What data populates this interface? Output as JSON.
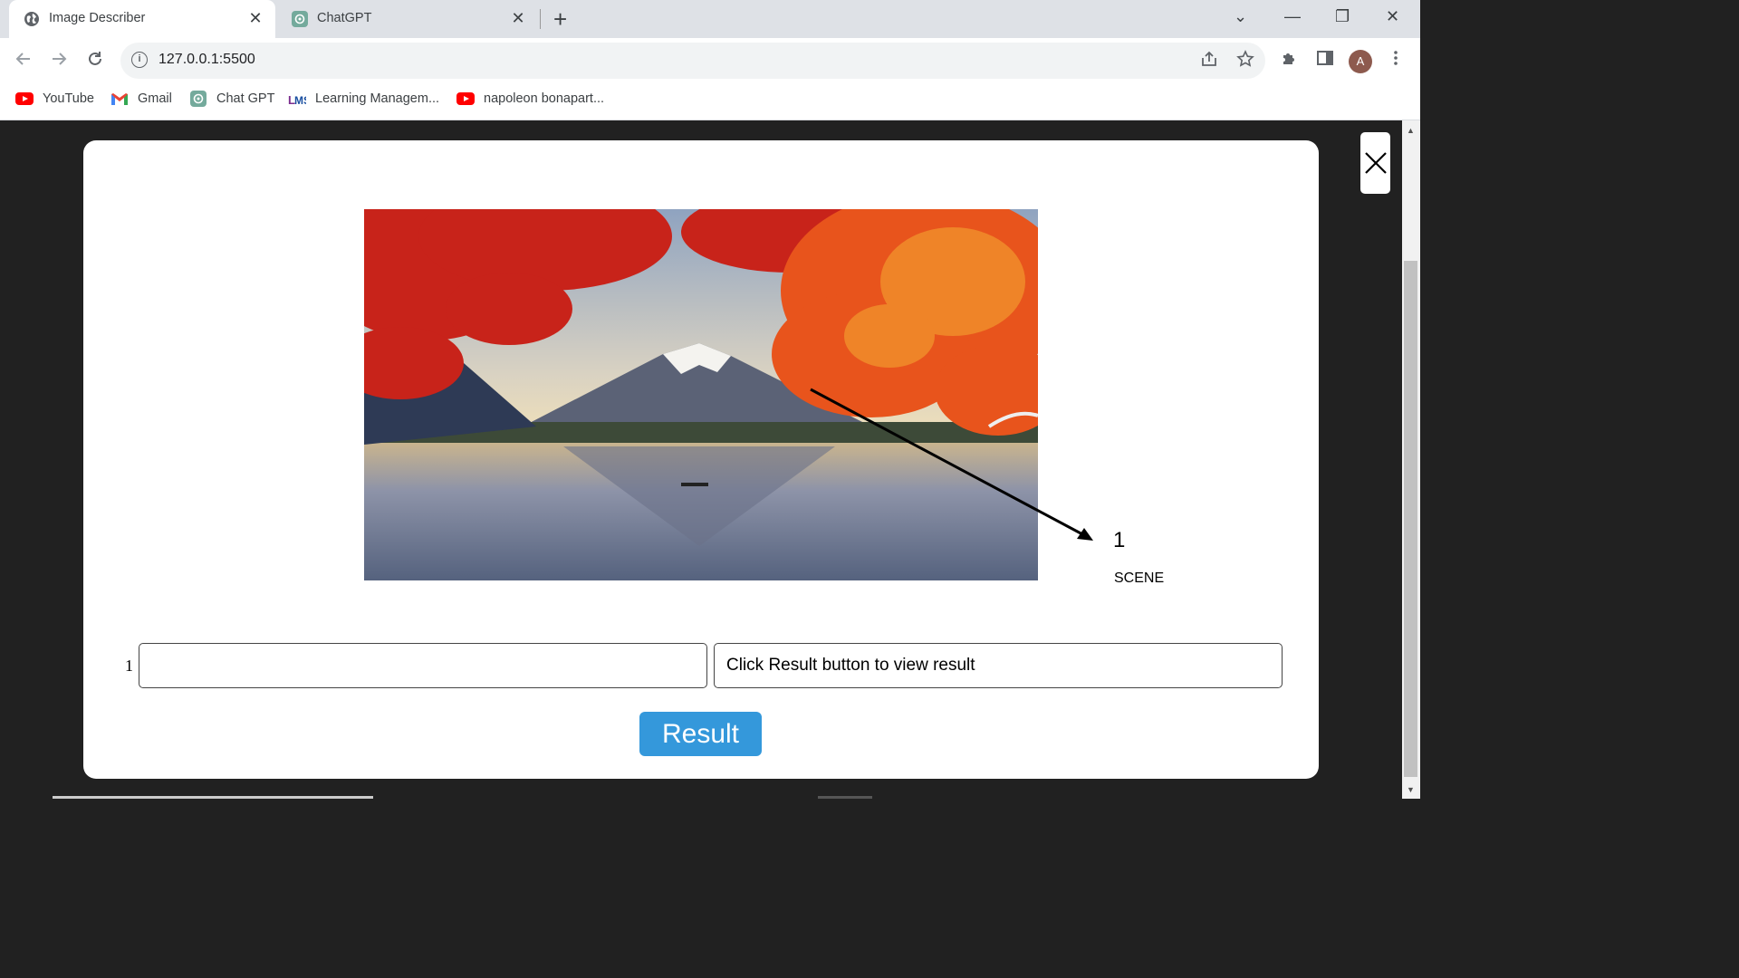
{
  "browser": {
    "tabs": [
      {
        "title": "Image Describer",
        "active": true,
        "icon": "globe-icon",
        "close": "✕"
      },
      {
        "title": "ChatGPT",
        "active": false,
        "icon": "openai-icon",
        "close": "✕"
      }
    ],
    "new_tab": "+",
    "window_controls": {
      "dropdown": "⌄",
      "minimize": "—",
      "restore": "❐",
      "close": "✕"
    },
    "url": "127.0.0.1:5500",
    "profile_initial": "A",
    "bookmarks": [
      {
        "label": "YouTube",
        "icon": "youtube-icon"
      },
      {
        "label": "Gmail",
        "icon": "gmail-icon"
      },
      {
        "label": "Chat GPT",
        "icon": "openai-icon"
      },
      {
        "label": "Learning Managem...",
        "icon": "lms-icon"
      },
      {
        "label": "napoleon bonapart...",
        "icon": "youtube-icon"
      }
    ]
  },
  "modal": {
    "image_alt": "mountain-lake-autumn-photo",
    "marker": {
      "number": "1",
      "label": "SCENE"
    },
    "row_index": "1",
    "answer_input": {
      "value": "",
      "placeholder": ""
    },
    "result_field": {
      "value": "Click Result button to view result"
    },
    "result_button": "Result"
  },
  "colors": {
    "accent": "#3498db",
    "backdrop": "#212121"
  }
}
